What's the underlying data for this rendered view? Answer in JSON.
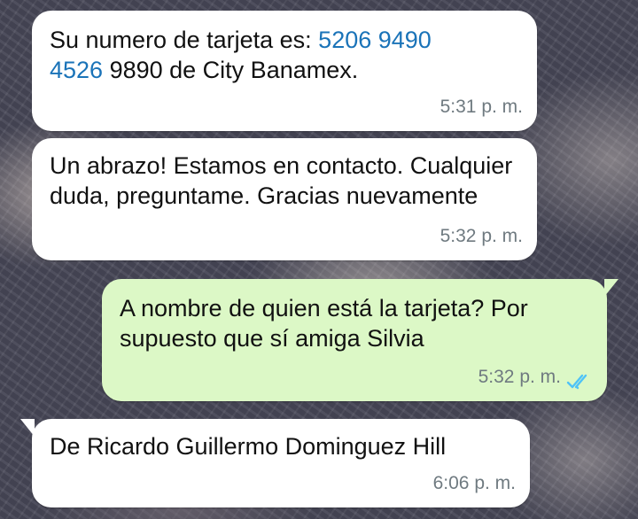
{
  "messages": [
    {
      "direction": "incoming",
      "text_before": "Su numero de tarjeta es: ",
      "phone_part1": "5206 9490",
      "phone_part2": "4526",
      "text_after": " 9890 de City Banamex.",
      "time": "5:31 p. m."
    },
    {
      "direction": "incoming",
      "text": "Un abrazo! Estamos en contacto. Cualquier duda, preguntame. Gracias nuevamente",
      "time": "5:32 p. m."
    },
    {
      "direction": "outgoing",
      "text": "A nombre de quien está la tarjeta? Por supuesto que sí amiga Silvia",
      "time": "5:32 p. m.",
      "status": "read",
      "status_icon": "double-check-icon",
      "status_color": "#4fc3f7"
    },
    {
      "direction": "incoming",
      "text": "De Ricardo Guillermo Dominguez Hill",
      "time": "6:06 p. m."
    }
  ],
  "colors": {
    "incoming_bubble": "#ffffff",
    "outgoing_bubble": "#dcf8c6",
    "link": "#1a73b8",
    "timestamp": "#6f7a80"
  }
}
